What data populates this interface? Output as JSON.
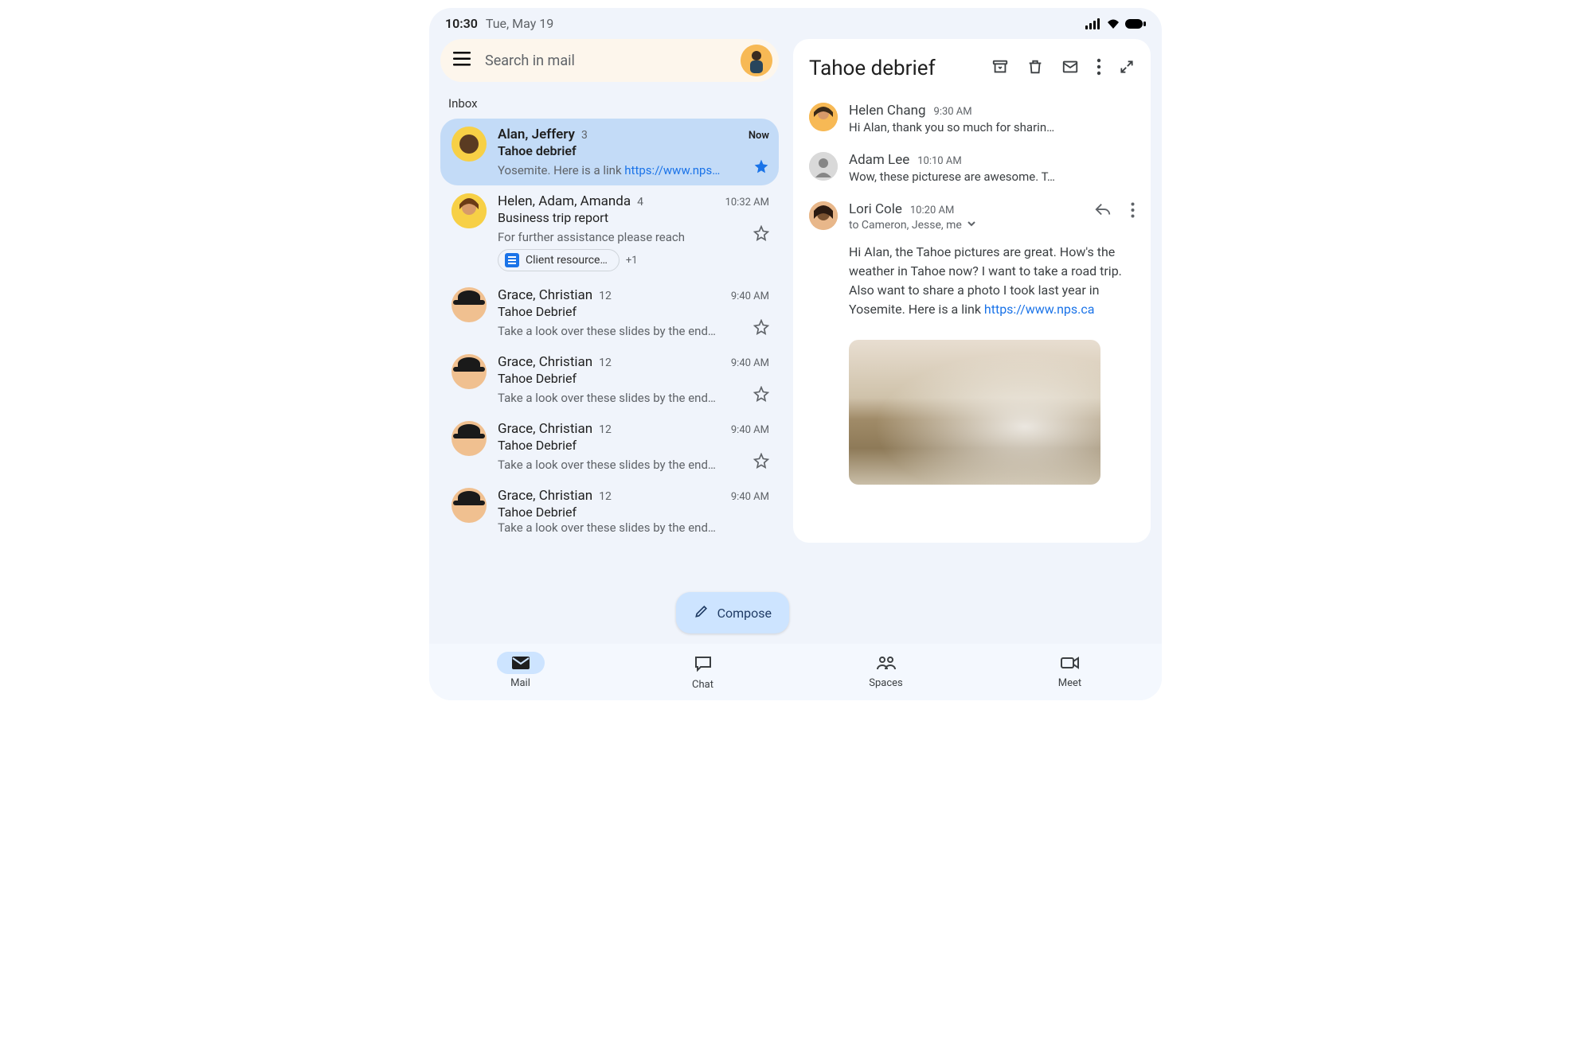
{
  "status": {
    "time": "10:30",
    "date": "Tue, May 19"
  },
  "search": {
    "placeholder": "Search in mail"
  },
  "inbox_label": "Inbox",
  "threads": [
    {
      "senders": "Alan, Jeffery",
      "count": "3",
      "time": "Now",
      "subject": "Tahoe debrief",
      "snippet_prefix": "Yosemite. Here is a link ",
      "snippet_link": "https://www.nps…",
      "starred": true,
      "unread": true,
      "selected": true
    },
    {
      "senders": "Helen, Adam, Amanda",
      "count": "4",
      "time": "10:32 AM",
      "subject": "Business trip report",
      "snippet": "For further assistance please reach",
      "attachment_chip": "Client resource…",
      "chip_more": "+1"
    },
    {
      "senders": "Grace, Christian",
      "count": "12",
      "time": "9:40 AM",
      "subject": "Tahoe Debrief",
      "snippet": "Take a look over these slides by the end…"
    },
    {
      "senders": "Grace, Christian",
      "count": "12",
      "time": "9:40 AM",
      "subject": "Tahoe Debrief",
      "snippet": "Take a look over these slides by the end…"
    },
    {
      "senders": "Grace, Christian",
      "count": "12",
      "time": "9:40 AM",
      "subject": "Tahoe Debrief",
      "snippet": "Take a look over these slides by the end…"
    },
    {
      "senders": "Grace, Christian",
      "count": "12",
      "time": "9:40 AM",
      "subject": "Tahoe Debrief",
      "snippet": "Take a look over these slides by the end…"
    }
  ],
  "compose_label": "Compose",
  "nav": {
    "mail": "Mail",
    "chat": "Chat",
    "spaces": "Spaces",
    "meet": "Meet"
  },
  "detail": {
    "title": "Tahoe debrief",
    "messages": [
      {
        "name": "Helen Chang",
        "time": "9:30 AM",
        "snippet": "Hi Alan, thank you so much for sharin…"
      },
      {
        "name": "Adam Lee",
        "time": "10:10 AM",
        "snippet": "Wow, these picturese are awesome. T…"
      },
      {
        "name": "Lori Cole",
        "time": "10:20 AM",
        "recipients": "to Cameron, Jesse, me",
        "body_prefix": "Hi Alan, the Tahoe pictures are great. How's the weather in Tahoe now? I want to take a road trip. Also want to share a photo I took last year in Yosemite. Here is a link ",
        "body_link": "https://www.nps.ca"
      }
    ]
  }
}
